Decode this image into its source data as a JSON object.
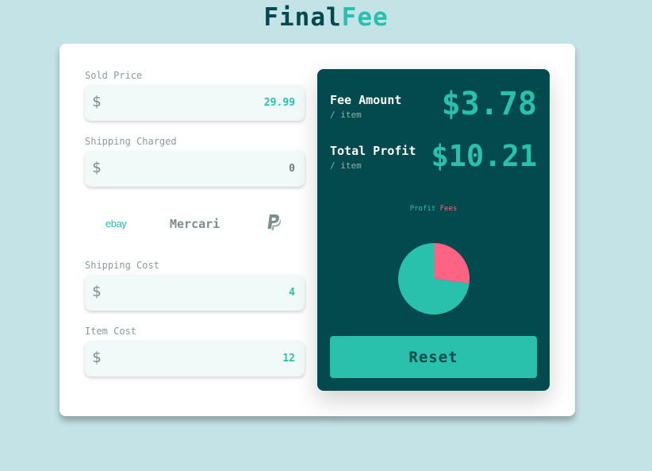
{
  "app": {
    "title_part1": "Final",
    "title_part2": "Fee"
  },
  "inputs": [
    {
      "label": "Sold Price",
      "currency": "$",
      "value": "29.99"
    },
    {
      "label": "Shipping Charged",
      "currency": "$",
      "value": "0"
    },
    {
      "label": "Shipping Cost",
      "currency": "$",
      "value": "4"
    },
    {
      "label": "Item Cost",
      "currency": "$",
      "value": "12"
    }
  ],
  "platforms": {
    "ebay": "ebay",
    "mercari": "Mercari",
    "paypal": "paypal-icon"
  },
  "results": {
    "fee_label": "Fee Amount",
    "fee_unit": "/ item",
    "fee_value": "$3.78",
    "profit_label": "Total Profit",
    "profit_unit": "/ item",
    "profit_value": "$10.21"
  },
  "chart_data": {
    "type": "pie",
    "labels": [
      "Profit",
      "Fees"
    ],
    "values": [
      10.21,
      3.78
    ],
    "colors": [
      "#29c1ab",
      "#ff6384"
    ],
    "legend_position": "top"
  },
  "reset_label": "Reset",
  "colors": {
    "accent": "#29c1ab",
    "dark": "#024a4d",
    "fees": "#ff6384",
    "background": "#c4e3e6"
  }
}
